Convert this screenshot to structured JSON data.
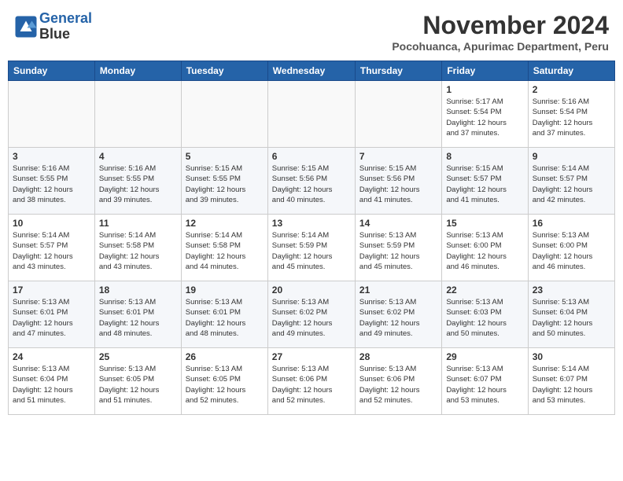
{
  "header": {
    "logo_line1": "General",
    "logo_line2": "Blue",
    "month": "November 2024",
    "location": "Pocohuanca, Apurimac Department, Peru"
  },
  "weekdays": [
    "Sunday",
    "Monday",
    "Tuesday",
    "Wednesday",
    "Thursday",
    "Friday",
    "Saturday"
  ],
  "weeks": [
    [
      {
        "day": "",
        "info": ""
      },
      {
        "day": "",
        "info": ""
      },
      {
        "day": "",
        "info": ""
      },
      {
        "day": "",
        "info": ""
      },
      {
        "day": "",
        "info": ""
      },
      {
        "day": "1",
        "info": "Sunrise: 5:17 AM\nSunset: 5:54 PM\nDaylight: 12 hours\nand 37 minutes."
      },
      {
        "day": "2",
        "info": "Sunrise: 5:16 AM\nSunset: 5:54 PM\nDaylight: 12 hours\nand 37 minutes."
      }
    ],
    [
      {
        "day": "3",
        "info": "Sunrise: 5:16 AM\nSunset: 5:55 PM\nDaylight: 12 hours\nand 38 minutes."
      },
      {
        "day": "4",
        "info": "Sunrise: 5:16 AM\nSunset: 5:55 PM\nDaylight: 12 hours\nand 39 minutes."
      },
      {
        "day": "5",
        "info": "Sunrise: 5:15 AM\nSunset: 5:55 PM\nDaylight: 12 hours\nand 39 minutes."
      },
      {
        "day": "6",
        "info": "Sunrise: 5:15 AM\nSunset: 5:56 PM\nDaylight: 12 hours\nand 40 minutes."
      },
      {
        "day": "7",
        "info": "Sunrise: 5:15 AM\nSunset: 5:56 PM\nDaylight: 12 hours\nand 41 minutes."
      },
      {
        "day": "8",
        "info": "Sunrise: 5:15 AM\nSunset: 5:57 PM\nDaylight: 12 hours\nand 41 minutes."
      },
      {
        "day": "9",
        "info": "Sunrise: 5:14 AM\nSunset: 5:57 PM\nDaylight: 12 hours\nand 42 minutes."
      }
    ],
    [
      {
        "day": "10",
        "info": "Sunrise: 5:14 AM\nSunset: 5:57 PM\nDaylight: 12 hours\nand 43 minutes."
      },
      {
        "day": "11",
        "info": "Sunrise: 5:14 AM\nSunset: 5:58 PM\nDaylight: 12 hours\nand 43 minutes."
      },
      {
        "day": "12",
        "info": "Sunrise: 5:14 AM\nSunset: 5:58 PM\nDaylight: 12 hours\nand 44 minutes."
      },
      {
        "day": "13",
        "info": "Sunrise: 5:14 AM\nSunset: 5:59 PM\nDaylight: 12 hours\nand 45 minutes."
      },
      {
        "day": "14",
        "info": "Sunrise: 5:13 AM\nSunset: 5:59 PM\nDaylight: 12 hours\nand 45 minutes."
      },
      {
        "day": "15",
        "info": "Sunrise: 5:13 AM\nSunset: 6:00 PM\nDaylight: 12 hours\nand 46 minutes."
      },
      {
        "day": "16",
        "info": "Sunrise: 5:13 AM\nSunset: 6:00 PM\nDaylight: 12 hours\nand 46 minutes."
      }
    ],
    [
      {
        "day": "17",
        "info": "Sunrise: 5:13 AM\nSunset: 6:01 PM\nDaylight: 12 hours\nand 47 minutes."
      },
      {
        "day": "18",
        "info": "Sunrise: 5:13 AM\nSunset: 6:01 PM\nDaylight: 12 hours\nand 48 minutes."
      },
      {
        "day": "19",
        "info": "Sunrise: 5:13 AM\nSunset: 6:01 PM\nDaylight: 12 hours\nand 48 minutes."
      },
      {
        "day": "20",
        "info": "Sunrise: 5:13 AM\nSunset: 6:02 PM\nDaylight: 12 hours\nand 49 minutes."
      },
      {
        "day": "21",
        "info": "Sunrise: 5:13 AM\nSunset: 6:02 PM\nDaylight: 12 hours\nand 49 minutes."
      },
      {
        "day": "22",
        "info": "Sunrise: 5:13 AM\nSunset: 6:03 PM\nDaylight: 12 hours\nand 50 minutes."
      },
      {
        "day": "23",
        "info": "Sunrise: 5:13 AM\nSunset: 6:04 PM\nDaylight: 12 hours\nand 50 minutes."
      }
    ],
    [
      {
        "day": "24",
        "info": "Sunrise: 5:13 AM\nSunset: 6:04 PM\nDaylight: 12 hours\nand 51 minutes."
      },
      {
        "day": "25",
        "info": "Sunrise: 5:13 AM\nSunset: 6:05 PM\nDaylight: 12 hours\nand 51 minutes."
      },
      {
        "day": "26",
        "info": "Sunrise: 5:13 AM\nSunset: 6:05 PM\nDaylight: 12 hours\nand 52 minutes."
      },
      {
        "day": "27",
        "info": "Sunrise: 5:13 AM\nSunset: 6:06 PM\nDaylight: 12 hours\nand 52 minutes."
      },
      {
        "day": "28",
        "info": "Sunrise: 5:13 AM\nSunset: 6:06 PM\nDaylight: 12 hours\nand 52 minutes."
      },
      {
        "day": "29",
        "info": "Sunrise: 5:13 AM\nSunset: 6:07 PM\nDaylight: 12 hours\nand 53 minutes."
      },
      {
        "day": "30",
        "info": "Sunrise: 5:14 AM\nSunset: 6:07 PM\nDaylight: 12 hours\nand 53 minutes."
      }
    ]
  ]
}
